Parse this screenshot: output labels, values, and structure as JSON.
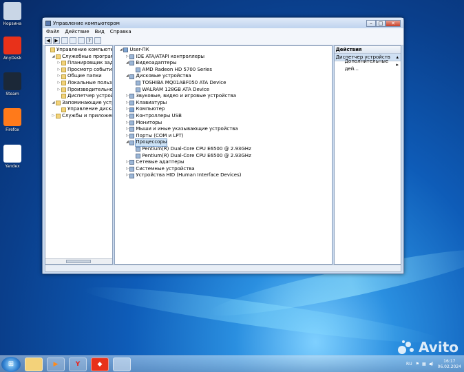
{
  "desktop": {
    "icons": [
      {
        "label": "Корзина",
        "color": "#c9d6e6"
      },
      {
        "label": "AnyDesk",
        "color": "#e8311a"
      },
      {
        "label": "Steam",
        "color": "#1b2838"
      },
      {
        "label": "Firefox",
        "color": "#ff7a1a"
      },
      {
        "label": "Yandex",
        "color": "#ffffff"
      }
    ]
  },
  "window": {
    "title": "Управление компьютером",
    "menu": [
      "Файл",
      "Действие",
      "Вид",
      "Справка"
    ],
    "left_tree": [
      {
        "label": "Управление компьютером (л",
        "level": 0,
        "exp": ""
      },
      {
        "label": "Служебные программы",
        "level": 1,
        "exp": "◢"
      },
      {
        "label": "Планировщик заданий",
        "level": 2,
        "exp": "▷"
      },
      {
        "label": "Просмотр событий",
        "level": 2,
        "exp": "▷"
      },
      {
        "label": "Общие папки",
        "level": 2,
        "exp": "▷"
      },
      {
        "label": "Локальные пользовате",
        "level": 2,
        "exp": "▷"
      },
      {
        "label": "Производительность",
        "level": 2,
        "exp": "▷"
      },
      {
        "label": "Диспетчер устройств",
        "level": 2,
        "exp": ""
      },
      {
        "label": "Запоминающие устройств",
        "level": 1,
        "exp": "◢"
      },
      {
        "label": "Управление дисками",
        "level": 2,
        "exp": ""
      },
      {
        "label": "Службы и приложения",
        "level": 1,
        "exp": "▷"
      }
    ],
    "device_tree": [
      {
        "label": "User-ПК",
        "level": 0,
        "exp": "◢",
        "icon": "comp"
      },
      {
        "label": "IDE ATA/ATAPI контроллеры",
        "level": 1,
        "exp": "▷",
        "icon": "dev"
      },
      {
        "label": "Видеоадаптеры",
        "level": 1,
        "exp": "◢",
        "icon": "dev"
      },
      {
        "label": "AMD Radeon HD 5700 Series",
        "level": 2,
        "exp": "",
        "icon": "dev"
      },
      {
        "label": "Дисковые устройства",
        "level": 1,
        "exp": "◢",
        "icon": "dev"
      },
      {
        "label": "TOSHIBA MQ01ABF050 ATA Device",
        "level": 2,
        "exp": "",
        "icon": "dev"
      },
      {
        "label": "WALRAM 128GB ATA Device",
        "level": 2,
        "exp": "",
        "icon": "dev"
      },
      {
        "label": "Звуковые, видео и игровые устройства",
        "level": 1,
        "exp": "▷",
        "icon": "dev"
      },
      {
        "label": "Клавиатуры",
        "level": 1,
        "exp": "▷",
        "icon": "dev"
      },
      {
        "label": "Компьютер",
        "level": 1,
        "exp": "▷",
        "icon": "comp"
      },
      {
        "label": "Контроллеры USB",
        "level": 1,
        "exp": "▷",
        "icon": "dev"
      },
      {
        "label": "Мониторы",
        "level": 1,
        "exp": "▷",
        "icon": "dev"
      },
      {
        "label": "Мыши и иные указывающие устройства",
        "level": 1,
        "exp": "▷",
        "icon": "dev"
      },
      {
        "label": "Порты (COM и LPT)",
        "level": 1,
        "exp": "▷",
        "icon": "dev"
      },
      {
        "label": "Процессоры",
        "level": 1,
        "exp": "◢",
        "icon": "dev",
        "selected": true
      },
      {
        "label": "Pentium(R) Dual-Core  CPU      E6500  @ 2.93GHz",
        "level": 2,
        "exp": "",
        "icon": "dev"
      },
      {
        "label": "Pentium(R) Dual-Core  CPU      E6500  @ 2.93GHz",
        "level": 2,
        "exp": "",
        "icon": "dev"
      },
      {
        "label": "Сетевые адаптеры",
        "level": 1,
        "exp": "▷",
        "icon": "dev"
      },
      {
        "label": "Системные устройства",
        "level": 1,
        "exp": "▷",
        "icon": "dev"
      },
      {
        "label": "Устройства HID (Human Interface Devices)",
        "level": 1,
        "exp": "▷",
        "icon": "dev"
      }
    ],
    "actions": {
      "header": "Действия",
      "selected": "Диспетчер устройств",
      "more": "Дополнительные дей..."
    }
  },
  "taskbar": {
    "lang": "RU",
    "time": "16:17",
    "date": "06.02.2024"
  },
  "watermark": "Avito"
}
